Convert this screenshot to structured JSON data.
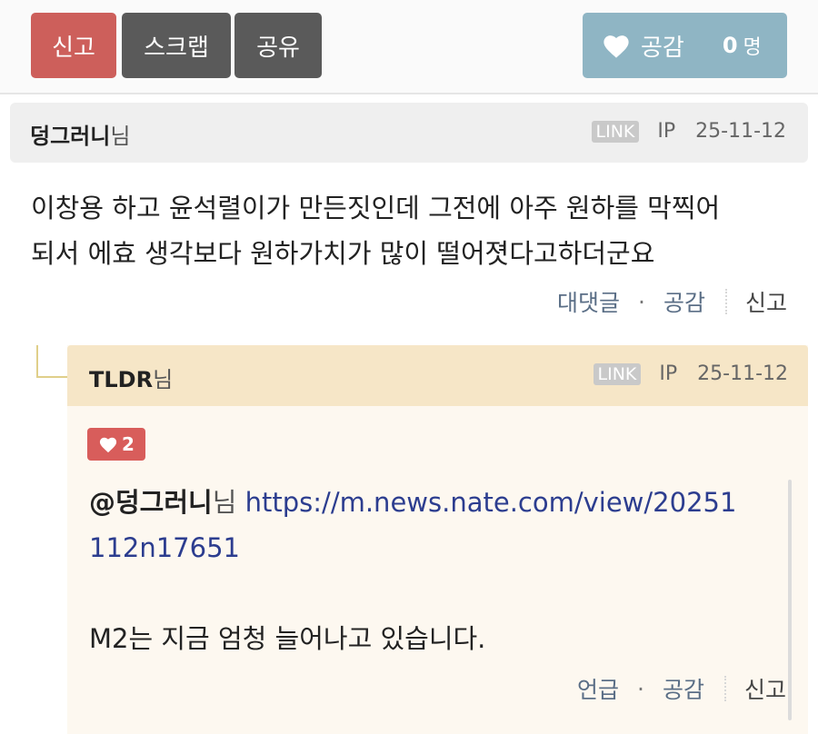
{
  "toolbar": {
    "report": "신고",
    "scrap": "스크랩",
    "share": "공유",
    "like_label": "공감",
    "like_count": "0",
    "like_unit": "명"
  },
  "comments": [
    {
      "author": "덩그러니",
      "author_suffix": "님",
      "link_badge": "LINK",
      "ip_label": "IP",
      "date": "25-11-12",
      "lines": [
        "이창용 하고 윤석렬이가 만든짓인데 그전에 아주 원하를 막찍어",
        "되서 에효 생각보다 원하가치가 많이 떨어졋다고하더군요"
      ],
      "actions": {
        "reply": "대댓글",
        "dot": "·",
        "like": "공감",
        "report": "신고"
      }
    }
  ],
  "reply": {
    "author": "TLDR",
    "author_suffix": "님",
    "link_badge": "LINK",
    "ip_label": "IP",
    "date": "25-11-12",
    "like_count": "2",
    "mention": "@덩그러니",
    "mention_suffix": "님",
    "url_line1": "https://m.news.nate.com/view/20251",
    "url_line2": "112n17651",
    "text": "M2는 지금 엄청 늘어나고 있습니다.",
    "actions": {
      "mention": "언급",
      "dot": "·",
      "like": "공감",
      "report": "신고"
    }
  },
  "colors": {
    "report_button": "#cd5f5b",
    "dark_button": "#5a5a5a",
    "like_button": "#8fb5c4",
    "reply_header": "#f6e6c7",
    "reply_background": "#fdf8f0",
    "heart_badge": "#d85d5b",
    "link_text": "#2c3d8f"
  },
  "icons": {
    "like_button": "heart-icon",
    "like_badge": "heart-icon"
  }
}
